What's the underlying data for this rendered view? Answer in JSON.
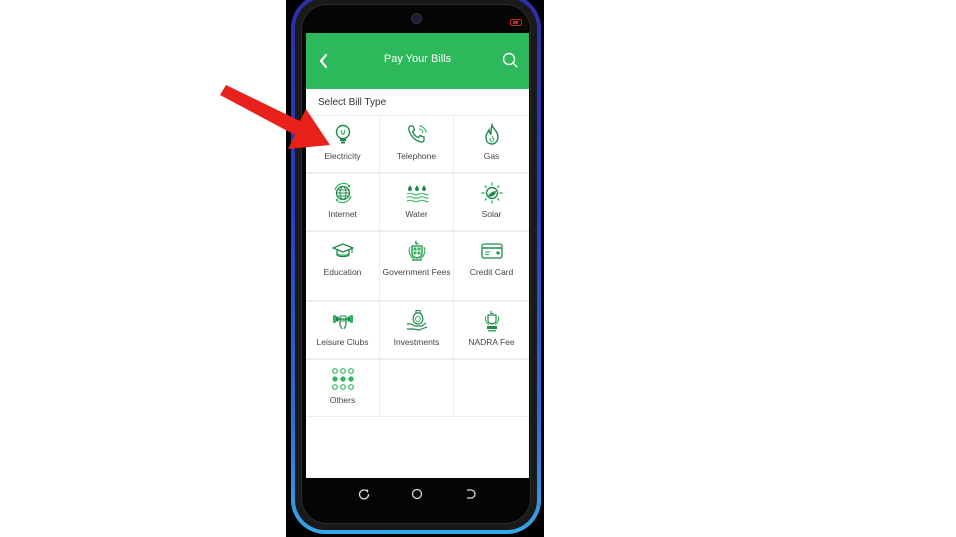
{
  "app": {
    "title": "Pay Your Bills",
    "back_icon": "chevron-left-icon",
    "search_icon": "search-icon"
  },
  "section": {
    "title": "Select Bill Type"
  },
  "bill_types": [
    {
      "label": "Electricity",
      "icon": "lightbulb-icon"
    },
    {
      "label": "Telephone",
      "icon": "phone-icon"
    },
    {
      "label": "Gas",
      "icon": "flame-icon"
    },
    {
      "label": "Internet",
      "icon": "globe-icon"
    },
    {
      "label": "Water",
      "icon": "water-drops-icon"
    },
    {
      "label": "Solar",
      "icon": "sun-icon"
    },
    {
      "label": "Education",
      "icon": "graduation-cap-icon"
    },
    {
      "label": "Government Fees",
      "icon": "government-emblem-icon"
    },
    {
      "label": "Credit Card",
      "icon": "credit-card-icon"
    },
    {
      "label": "Leisure Clubs",
      "icon": "dumbbell-icon"
    },
    {
      "label": "Investments",
      "icon": "money-bag-hand-icon"
    },
    {
      "label": "NADRA Fee",
      "icon": "nadra-emblem-icon"
    },
    {
      "label": "Others",
      "icon": "dots-grid-icon"
    }
  ],
  "colors": {
    "accent": "#2eb85c",
    "icon": "#1f8a4c",
    "annotation_arrow": "#e8211d"
  },
  "system_nav": {
    "recent": "recent-apps-icon",
    "home": "home-icon",
    "back": "back-icon"
  },
  "annotation": {
    "arrow_target": "Electricity"
  }
}
